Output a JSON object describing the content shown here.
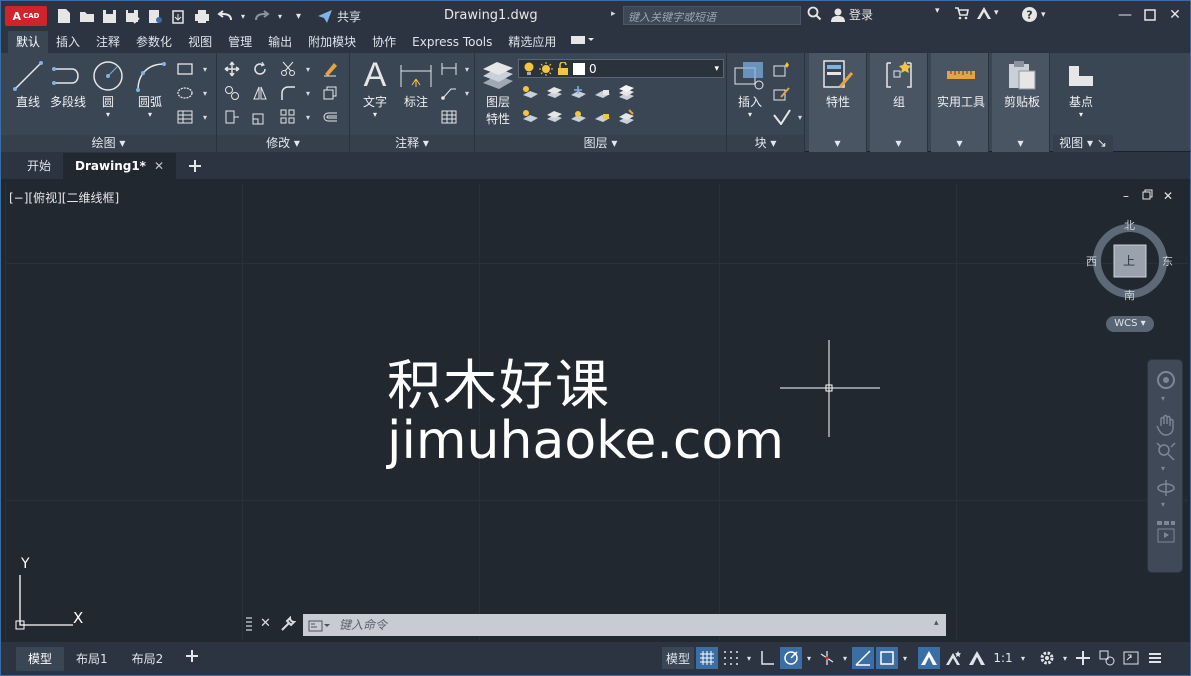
{
  "app": {
    "logo_text": "A",
    "logo_sub": "CAD",
    "doc_title": "Drawing1.dwg",
    "share_label": "共享"
  },
  "search": {
    "placeholder": "键入关键字或短语"
  },
  "user": {
    "login_label": "登录"
  },
  "ribbon_tabs": [
    "默认",
    "插入",
    "注释",
    "参数化",
    "视图",
    "管理",
    "输出",
    "附加模块",
    "协作",
    "Express Tools",
    "精选应用"
  ],
  "panels": {
    "draw": {
      "title": "绘图",
      "line": "直线",
      "polyline": "多段线",
      "circle": "圆",
      "arc": "圆弧"
    },
    "modify": {
      "title": "修改"
    },
    "annotation": {
      "title": "注释",
      "text": "文字",
      "dimension": "标注"
    },
    "layers": {
      "title": "图层",
      "properties_line1": "图层",
      "properties_line2": "特性",
      "current_layer": "0"
    },
    "block": {
      "title": "块",
      "insert": "插入"
    },
    "properties": {
      "label": "特性"
    },
    "groups": {
      "label": "组"
    },
    "utilities": {
      "label": "实用工具"
    },
    "clipboard": {
      "label": "剪贴板"
    },
    "view": {
      "title": "视图",
      "base": "基点"
    }
  },
  "file_tabs": {
    "start": "开始",
    "drawing": "Drawing1*"
  },
  "viewport": {
    "label": "[−][俯视][二维线框]"
  },
  "watermark": {
    "cn": "积木好课",
    "url": "jimuhaoke.com"
  },
  "viewcube": {
    "north": "北",
    "south": "南",
    "east": "东",
    "west": "西",
    "top": "上",
    "wcs": "WCS"
  },
  "ucs": {
    "x": "X",
    "y": "Y"
  },
  "command": {
    "placeholder": "键入命令"
  },
  "layout_tabs": [
    "模型",
    "布局1",
    "布局2"
  ],
  "status": {
    "model_label": "模型",
    "scale": "1:1"
  },
  "colors": {
    "accent": "#3a6ea5",
    "canvas": "#212830",
    "ribbon": "#3b4655"
  }
}
